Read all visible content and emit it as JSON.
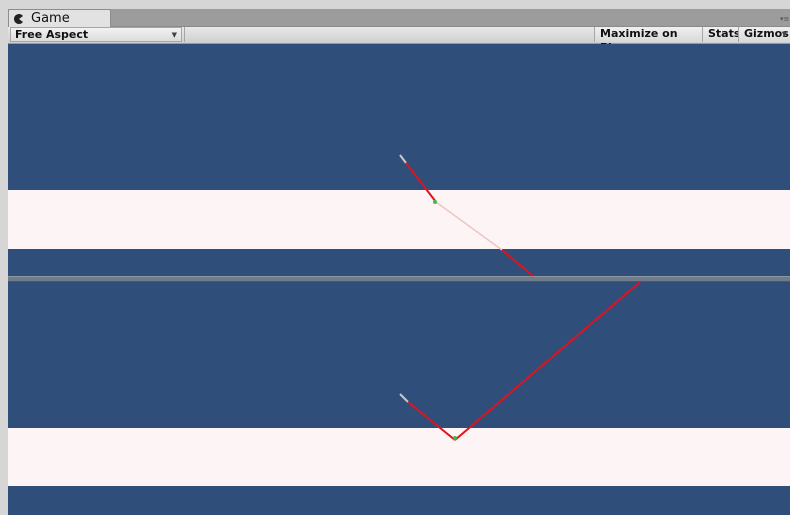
{
  "window": {
    "tab_title": "Game",
    "tab_icon": "pacman-icon",
    "tab_menu_icon": "tab-menu-icon"
  },
  "toolbar": {
    "aspect_label": "Free Aspect",
    "maximize_label": "Maximize on Play",
    "stats_label": "Stats",
    "gizmos_label": "Gizmos"
  },
  "colors": {
    "sky": "#2f4f7a",
    "band": "#fdf5f5",
    "ray": "#e0121f",
    "ray_faint": "#f0c4c4",
    "hit_marker": "#3fbf3f"
  }
}
